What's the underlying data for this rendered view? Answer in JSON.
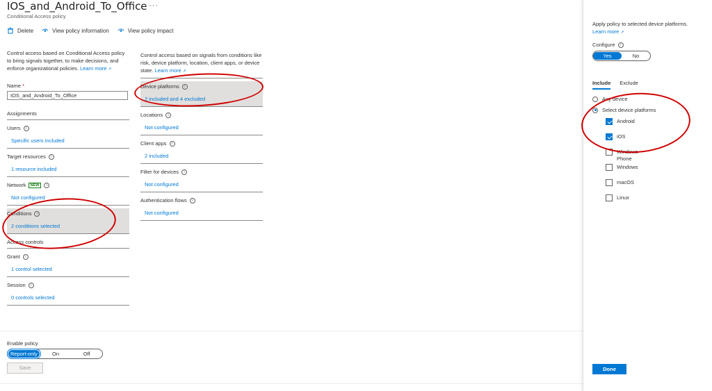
{
  "header": {
    "title": "IOS_and_Android_To_Office",
    "more": "···",
    "subtitle": "Conditional Access policy"
  },
  "toolbar": {
    "delete_label": "Delete",
    "view_info_label": "View policy information",
    "view_impact_label": "View policy impact"
  },
  "left": {
    "description": "Control access based on Conditional Access policy to bring signals together, to make decisions, and enforce organizational policies.",
    "learn_more": "Learn more",
    "name_label": "Name",
    "name_required": "*",
    "name_value": "IOS_and_Android_To_Office",
    "assignments_heading": "Assignments",
    "users_label": "Users",
    "users_value": "Specific users included",
    "target_label": "Target resources",
    "target_value": "1 resource included",
    "network_label": "Network",
    "network_badge": "NEW",
    "network_value": "Not configured",
    "conditions_label": "Conditions",
    "conditions_value": "2 conditions selected",
    "access_heading": "Access controls",
    "grant_label": "Grant",
    "grant_value": "1 control selected",
    "session_label": "Session",
    "session_value": "0 controls selected"
  },
  "middle": {
    "description": "Control access based on signals from conditions like risk, device platform, location, client apps, or device state.",
    "learn_more": "Learn more",
    "device_platforms_label": "Device platforms",
    "device_platforms_value": "2 included and 4 excluded",
    "locations_label": "Locations",
    "locations_value": "Not configured",
    "client_apps_label": "Client apps",
    "client_apps_value": "2 included",
    "filter_label": "Filter for devices",
    "filter_value": "Not configured",
    "auth_flows_label": "Authentication flows",
    "auth_flows_value": "Not configured"
  },
  "footer": {
    "enable_label": "Enable policy",
    "opt_report": "Report-only",
    "opt_on": "On",
    "opt_off": "Off",
    "save_label": "Save"
  },
  "panel": {
    "intro": "Apply policy to selected device platforms.",
    "learn_more": "Learn more",
    "configure_label": "Configure",
    "yes": "Yes",
    "no": "No",
    "tab_include": "Include",
    "tab_exclude": "Exclude",
    "any_device": "Any device",
    "select_platforms": "Select device platforms",
    "platforms": [
      {
        "label": "Android",
        "checked": true
      },
      {
        "label": "iOS",
        "checked": true
      },
      {
        "label": "Windows Phone",
        "checked": false
      },
      {
        "label": "Windows",
        "checked": false
      },
      {
        "label": "macOS",
        "checked": false
      },
      {
        "label": "Linux",
        "checked": false
      }
    ],
    "done_label": "Done"
  },
  "colors": {
    "accent": "#0078d4",
    "annotation": "#d00000",
    "selected_row": "#e1dfdd"
  }
}
